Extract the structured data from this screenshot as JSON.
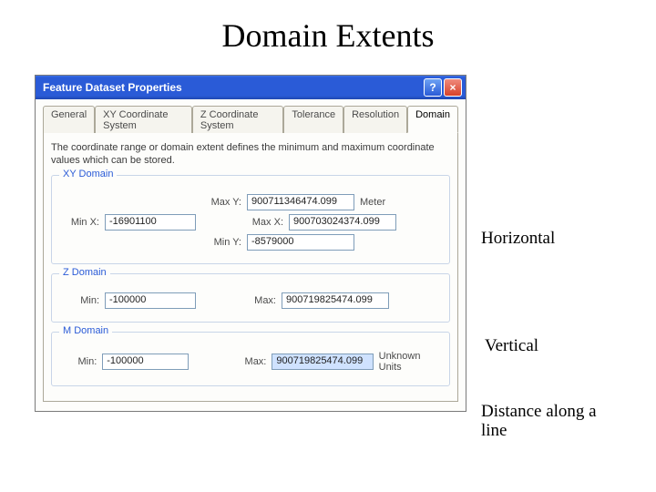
{
  "slide": {
    "title": "Domain Extents"
  },
  "window": {
    "title": "Feature Dataset Properties",
    "help": "?",
    "close": "×"
  },
  "tabs": {
    "general": "General",
    "xy": "XY Coordinate System",
    "z": "Z Coordinate System",
    "tol": "Tolerance",
    "res": "Resolution",
    "domain": "Domain"
  },
  "desc": "The coordinate range or domain extent defines the minimum and maximum coordinate values which can be stored.",
  "xyDomain": {
    "legend": "XY Domain",
    "maxY_label": "Max Y:",
    "maxY": "900711346474.099",
    "unit": "Meter",
    "minX_label": "Min X:",
    "minX": "-16901100",
    "maxX_label": "Max X:",
    "maxX": "900703024374.099",
    "minY_label": "Min Y:",
    "minY": "-8579000"
  },
  "zDomain": {
    "legend": "Z Domain",
    "min_label": "Min:",
    "min": "-100000",
    "max_label": "Max:",
    "max": "900719825474.099"
  },
  "mDomain": {
    "legend": "M Domain",
    "min_label": "Min:",
    "min": "-100000",
    "max_label": "Max:",
    "max": "900719825474.099",
    "unit": "Unknown Units"
  },
  "annotations": {
    "horizontal": "Horizontal",
    "vertical": "Vertical",
    "m": "Distance along a line"
  }
}
